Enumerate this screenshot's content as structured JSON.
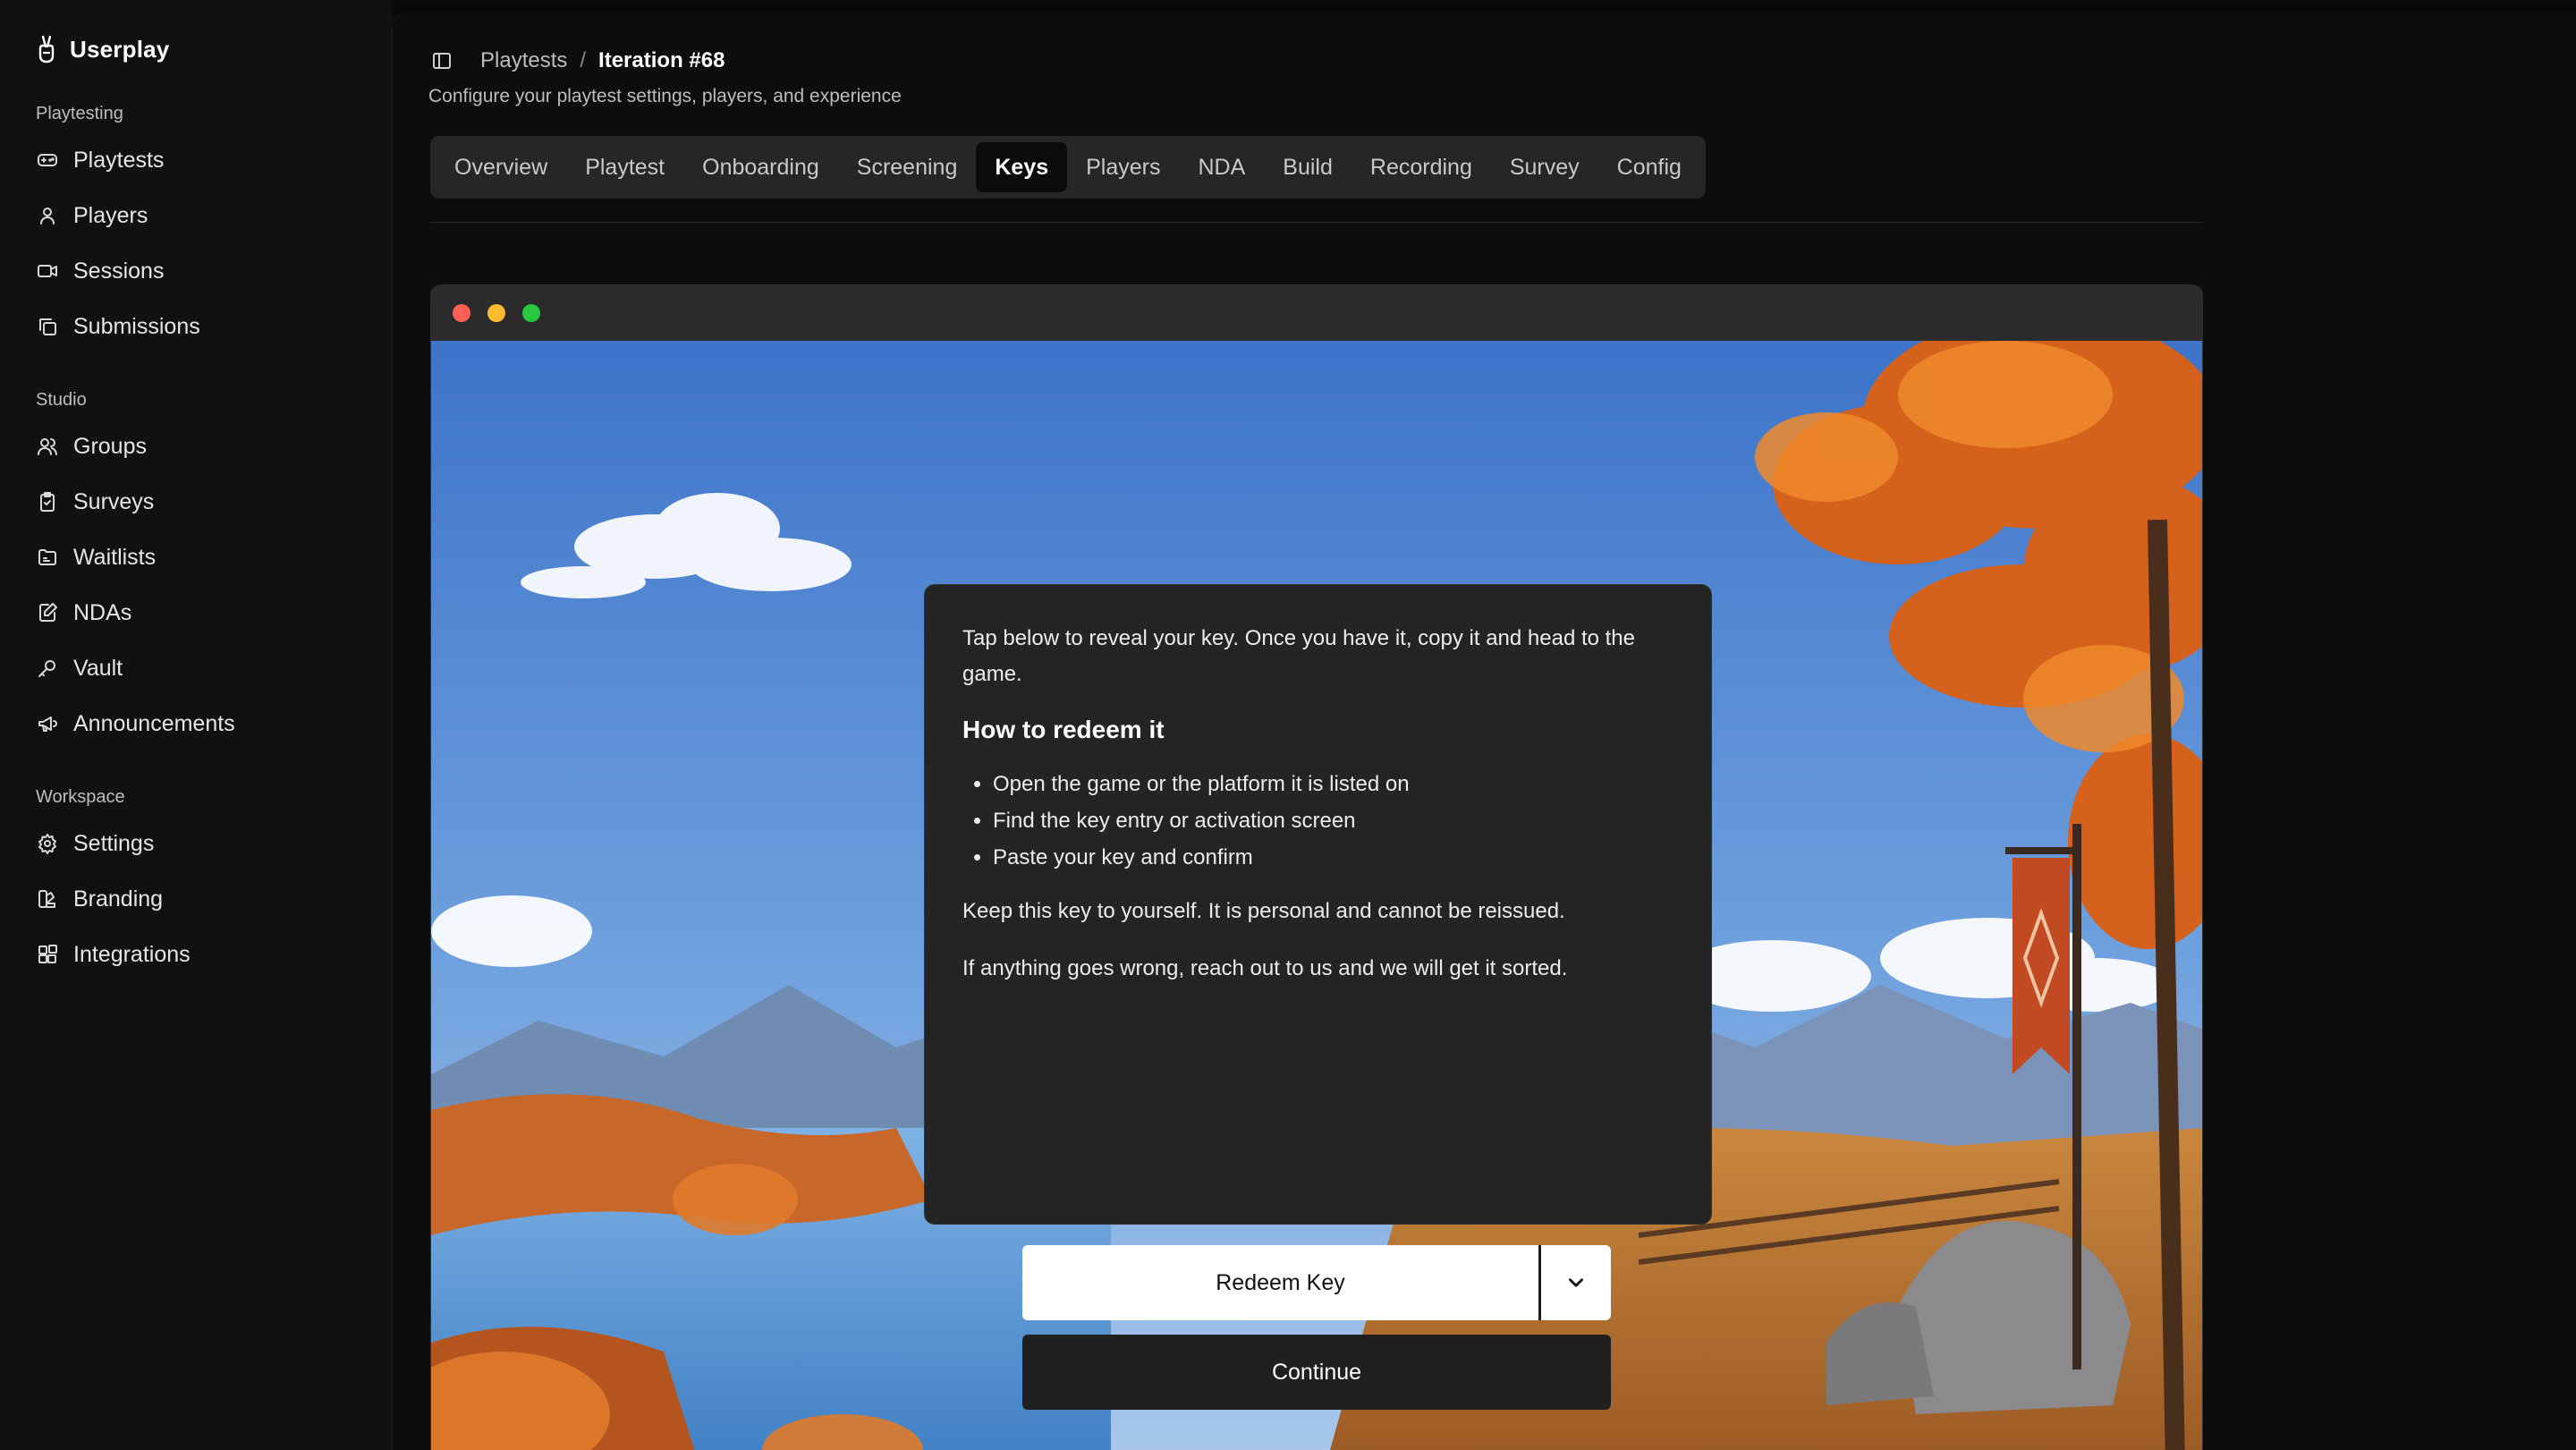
{
  "app": {
    "name": "Userplay"
  },
  "sidebar": {
    "sections": [
      {
        "title": "Playtesting",
        "items": [
          {
            "label": "Playtests",
            "icon": "gamepad-icon"
          },
          {
            "label": "Players",
            "icon": "user-icon"
          },
          {
            "label": "Sessions",
            "icon": "video-icon"
          },
          {
            "label": "Submissions",
            "icon": "copy-icon"
          }
        ]
      },
      {
        "title": "Studio",
        "items": [
          {
            "label": "Groups",
            "icon": "users-icon"
          },
          {
            "label": "Surveys",
            "icon": "clipboard-icon"
          },
          {
            "label": "Waitlists",
            "icon": "folder-list-icon"
          },
          {
            "label": "NDAs",
            "icon": "edit-document-icon"
          },
          {
            "label": "Vault",
            "icon": "key-icon"
          },
          {
            "label": "Announcements",
            "icon": "megaphone-icon"
          }
        ]
      },
      {
        "title": "Workspace",
        "items": [
          {
            "label": "Settings",
            "icon": "gear-icon"
          },
          {
            "label": "Branding",
            "icon": "palette-icon"
          },
          {
            "label": "Integrations",
            "icon": "blocks-icon"
          }
        ]
      }
    ]
  },
  "header": {
    "breadcrumb_root": "Playtests",
    "breadcrumb_sep": "/",
    "breadcrumb_current": "Iteration #68",
    "subtitle": "Configure your playtest settings, players, and experience"
  },
  "tabs": {
    "items": [
      "Overview",
      "Playtest",
      "Onboarding",
      "Screening",
      "Keys",
      "Players",
      "NDA",
      "Build",
      "Recording",
      "Survey",
      "Config"
    ],
    "active": "Keys"
  },
  "preview": {
    "card": {
      "intro": "Tap below to reveal your key. Once you have it, copy it and head to the game.",
      "heading": "How to redeem it",
      "steps": [
        "Open the game or the platform it is listed on",
        "Find the key entry or activation screen",
        "Paste your key and confirm"
      ],
      "note": "Keep this key to yourself. It is personal and cannot be reissued.",
      "help": "If anything goes wrong, reach out to us and we will get it sorted."
    },
    "redeem_label": "Redeem Key",
    "continue_label": "Continue"
  },
  "colors": {
    "accent_active_tab": "#0b0b0b",
    "traffic_red": "#ff5f57",
    "traffic_yellow": "#febc2e",
    "traffic_green": "#28c840"
  }
}
